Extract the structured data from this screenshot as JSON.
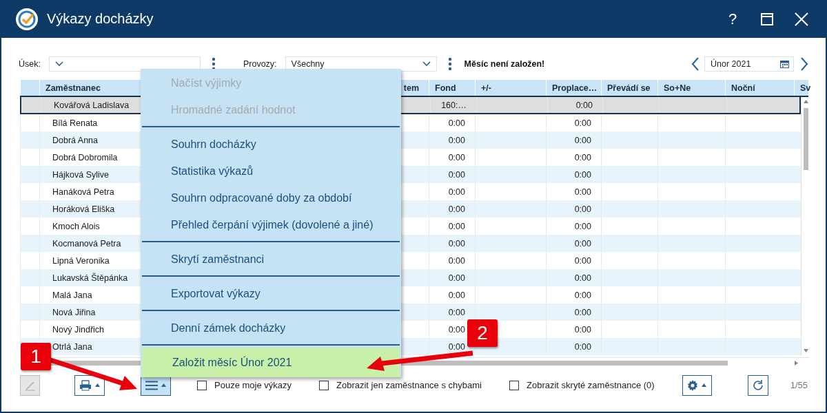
{
  "window": {
    "title": "Výkazy docházky",
    "help": "?"
  },
  "filters": {
    "usek_label": "Úsek:",
    "provozy_label": "Provozy:",
    "provozy_value": "Všechny",
    "status": "Měsíc není založen!",
    "month": "Únor 2021"
  },
  "table": {
    "columns": [
      "Zaměstnanec",
      "tem",
      "Fond",
      "+/-",
      "Proplace…",
      "Převádí se",
      "So+Ne",
      "Noční",
      "Sv"
    ],
    "rows": [
      {
        "name": "Kovářová Ladislava",
        "fond": "160:…",
        "proplaceni": "0:00",
        "selected": true
      },
      {
        "name": "Bílá Renata",
        "fond": "0:00",
        "proplaceni": "0:00",
        "selected": false
      },
      {
        "name": "Dobrá Anna",
        "fond": "0:00",
        "proplaceni": "0:00",
        "selected": false
      },
      {
        "name": "Dobrá Dobromila",
        "fond": "0:00",
        "proplaceni": "0:00",
        "selected": false
      },
      {
        "name": "Hájková Sylive",
        "fond": "0:00",
        "proplaceni": "0:00",
        "selected": false
      },
      {
        "name": "Hanáková Petra",
        "fond": "0:00",
        "proplaceni": "0:00",
        "selected": false
      },
      {
        "name": "Horáková Eliška",
        "fond": "0:00",
        "proplaceni": "0:00",
        "selected": false
      },
      {
        "name": "Kmoch Alois",
        "fond": "0:00",
        "proplaceni": "0:00",
        "selected": false
      },
      {
        "name": "Kocmanová Petra",
        "fond": "0:00",
        "proplaceni": "0:00",
        "selected": false
      },
      {
        "name": "Lipná Veronika",
        "fond": "0:00",
        "proplaceni": "0:00",
        "selected": false
      },
      {
        "name": "Lukavská Štěpánka",
        "fond": "0:00",
        "proplaceni": "0:00",
        "selected": false
      },
      {
        "name": "Malá Jana",
        "fond": "0:00",
        "proplaceni": "0:00",
        "selected": false
      },
      {
        "name": "Nová Jiřina",
        "fond": "0:00",
        "proplaceni": "0:00",
        "selected": false
      },
      {
        "name": "Nový Jindřich",
        "fond": "0:00",
        "proplaceni": "0:00",
        "selected": false
      },
      {
        "name": "Otrlá Jana",
        "fond": "0:00",
        "proplaceni": "0:00",
        "selected": false
      }
    ]
  },
  "menu": {
    "groups": [
      [
        {
          "label": "Načíst výjimky",
          "disabled": true,
          "selected": false
        },
        {
          "label": "Hromadné zadání hodnot",
          "disabled": true,
          "selected": false
        }
      ],
      [
        {
          "label": "Souhrn docházky",
          "disabled": false,
          "selected": false
        },
        {
          "label": "Statistika výkazů",
          "disabled": false,
          "selected": false
        },
        {
          "label": "Souhrn odpracované doby za období",
          "disabled": false,
          "selected": false
        },
        {
          "label": "Přehled čerpání výjimek (dovolené a jiné)",
          "disabled": false,
          "selected": false
        }
      ],
      [
        {
          "label": "Skrytí zaměstnanci",
          "disabled": false,
          "selected": false
        }
      ],
      [
        {
          "label": "Exportovat výkazy",
          "disabled": false,
          "selected": false
        }
      ],
      [
        {
          "label": "Denní zámek docházky",
          "disabled": false,
          "selected": false
        }
      ],
      [
        {
          "label": "Založit měsíc Únor 2021",
          "disabled": false,
          "selected": true
        }
      ]
    ]
  },
  "bottom_bar": {
    "edit_disabled": true,
    "menu_open": true,
    "checkboxes": [
      {
        "label": "Pouze moje výkazy",
        "checked": false
      },
      {
        "label": "Zobrazit jen zaměstnance s chybami",
        "checked": false
      },
      {
        "label": "Zobrazit skryté zaměstnance (0)",
        "checked": false
      }
    ],
    "counter": "1/55"
  },
  "annotations": [
    {
      "label": "1"
    },
    {
      "label": "2"
    }
  ]
}
